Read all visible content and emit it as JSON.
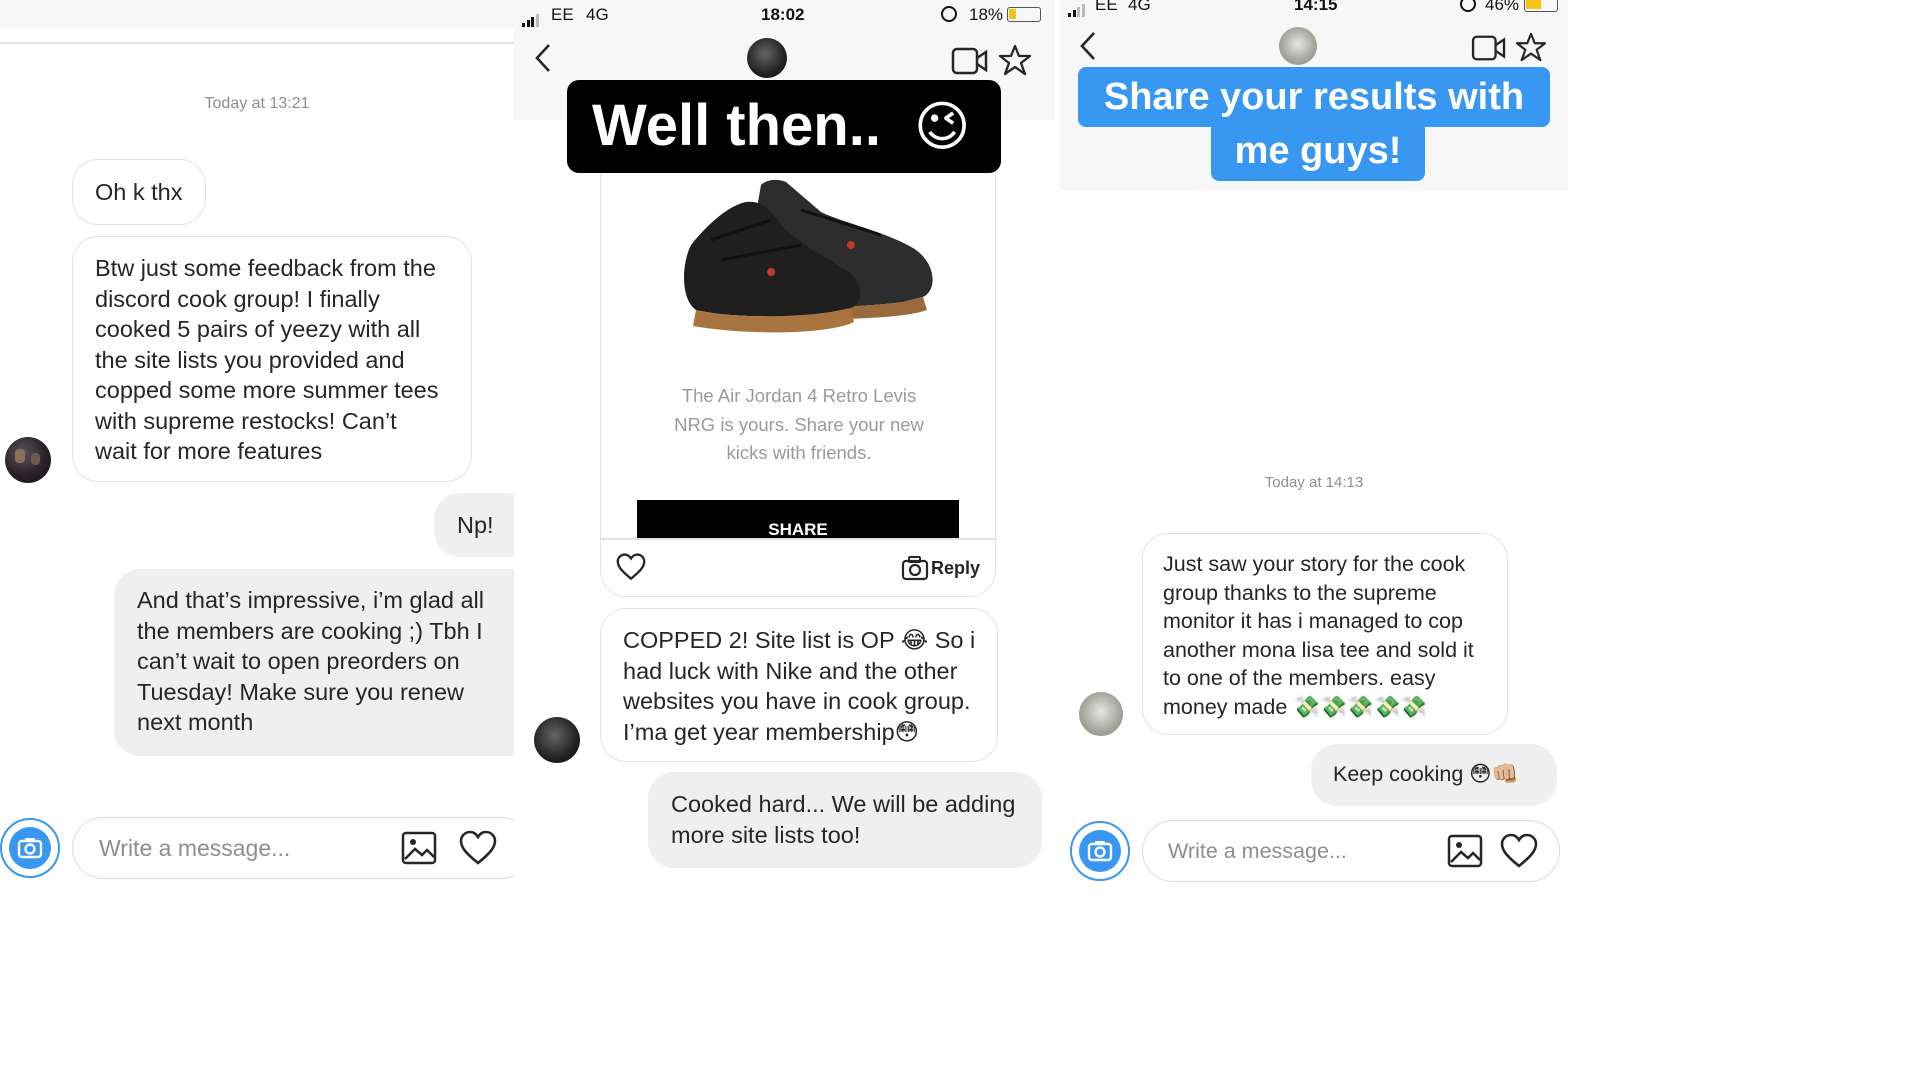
{
  "panel1": {
    "timestamp": "Today at 13:21",
    "msg1": "Oh k thx",
    "msg2": "Btw just some feedback from the\ndiscord cook group! I finally\ncooked 5 pairs of yeezy with all\nthe site lists you provided and\ncopped some more summer tees\nwith supreme restocks! Can’t\nwait for more features",
    "msg3": "Np!",
    "msg4": "And that’s impressive, i’m glad all\nthe members are cooking ;) Tbh I\ncan’t wait to open preorders on\nTuesday! Make sure you renew\nnext month",
    "composer_placeholder": "Write a message..."
  },
  "panel2": {
    "status": {
      "carrier": "EE",
      "network": "4G",
      "time": "18:02",
      "battery": "18%"
    },
    "sticker": "Well then..",
    "sticker_emoji": "😉",
    "shared_post": {
      "caption": "The Air Jordan 4 Retro Levis\nNRG is yours. Share your new\nkicks with friends.",
      "share_button": "SHARE",
      "reply_label": "Reply"
    },
    "msg1": "COPPED 2! Site list is OP 😂 So i\nhad luck with Nike and the other\nwebsites you have in cook group.\nI’ma get year membership😳",
    "msg2": "Cooked hard... We will be adding\nmore site lists too!"
  },
  "panel3": {
    "status": {
      "carrier": "EE",
      "network": "4G",
      "time": "14:15",
      "battery": "46%"
    },
    "sticker_line1": "Share your results with",
    "sticker_line2": "me guys!",
    "timestamp": "Today at 14:13",
    "msg1": "Just saw your story for the cook\ngroup thanks to the supreme\nmonitor it has i managed to cop\nanother mona lisa tee and sold it\nto one of the members. easy\nmoney made 💸💸💸💸💸",
    "msg2": "Keep cooking 😳👊🏼",
    "composer_placeholder": "Write a message..."
  },
  "colors": {
    "accent_blue": "#3897f0",
    "bubble_gray": "#efefef",
    "border_gray": "#e3e3e3",
    "timestamp_gray": "#8e8e8e",
    "battery_yellow": "#f5c518"
  },
  "icons": [
    "camera-icon",
    "image-icon",
    "heart-icon",
    "back-chevron-icon",
    "video-call-icon",
    "star-icon",
    "reply-camera-icon",
    "sneaker-image",
    "avatar"
  ]
}
